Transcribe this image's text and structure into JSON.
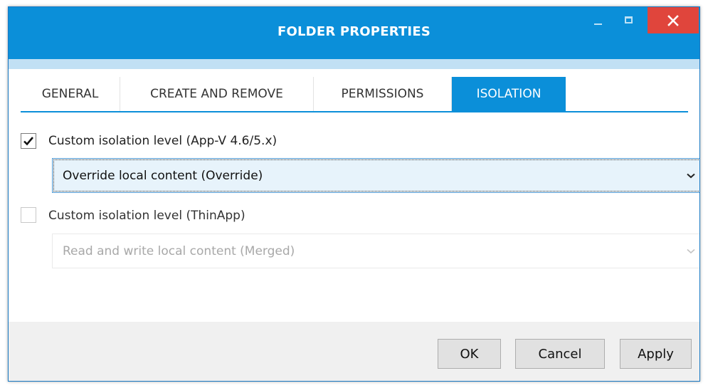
{
  "window": {
    "title": "FOLDER PROPERTIES"
  },
  "title_buttons": {
    "minimize": "minimize",
    "maximize": "maximize",
    "close": "close"
  },
  "tabs": [
    {
      "label": "GENERAL",
      "active": false
    },
    {
      "label": "CREATE AND REMOVE",
      "active": false
    },
    {
      "label": "PERMISSIONS",
      "active": false
    },
    {
      "label": "ISOLATION",
      "active": true
    }
  ],
  "appv": {
    "checked": true,
    "label": "Custom isolation level (App-V 4.6/5.x)",
    "selected_value": "Override local content (Override)"
  },
  "thinapp": {
    "checked": false,
    "label": "Custom isolation level (ThinApp)",
    "selected_value": "Read and write local content (Merged)"
  },
  "buttons": {
    "ok": "OK",
    "cancel": "Cancel",
    "apply": "Apply"
  },
  "colors": {
    "accent": "#0b8fd9",
    "close": "#e0453c",
    "subband": "#c1e0f4",
    "footer": "#f0f0f0"
  },
  "icons": [
    "minimize-icon",
    "maximize-icon",
    "close-icon",
    "checkmark-icon",
    "chevron-down-icon"
  ]
}
